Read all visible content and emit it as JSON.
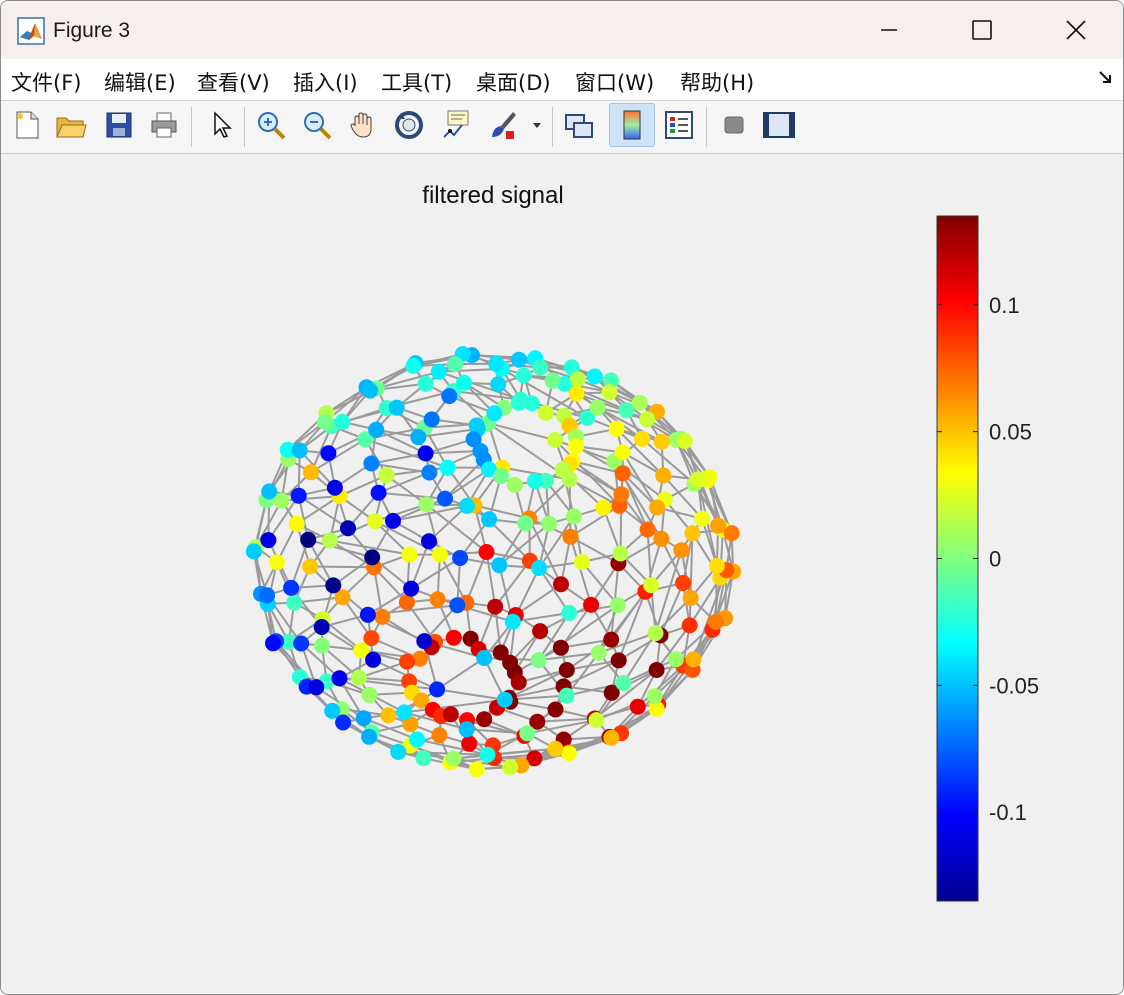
{
  "window": {
    "title": "Figure 3"
  },
  "menu": [
    {
      "label": "文件(F)"
    },
    {
      "label": "编辑(E)"
    },
    {
      "label": "查看(V)"
    },
    {
      "label": "插入(I)"
    },
    {
      "label": "工具(T)"
    },
    {
      "label": "桌面(D)"
    },
    {
      "label": "窗口(W)"
    },
    {
      "label": "帮助(H)"
    }
  ],
  "toolbar": [
    {
      "icon": "new-figure-icon"
    },
    {
      "icon": "open-file-icon"
    },
    {
      "icon": "save-icon"
    },
    {
      "icon": "print-icon"
    },
    {
      "icon": "pointer-icon"
    },
    {
      "icon": "zoom-in-icon"
    },
    {
      "icon": "zoom-out-icon"
    },
    {
      "icon": "pan-hand-icon"
    },
    {
      "icon": "rotate-3d-icon"
    },
    {
      "icon": "data-cursor-icon"
    },
    {
      "icon": "brush-icon"
    },
    {
      "icon": "link-plot-icon"
    },
    {
      "icon": "colorbar-icon",
      "active": true
    },
    {
      "icon": "legend-icon"
    },
    {
      "icon": "hide-plot-tools-icon"
    },
    {
      "icon": "show-plot-tools-icon"
    }
  ],
  "figure": {
    "title": "filtered signal"
  },
  "chart_data": {
    "type": "scatter",
    "title": "filtered signal",
    "colormap": "jet",
    "colorbar": {
      "range": [
        -0.135,
        0.135
      ],
      "ticks": [
        0.1,
        0.05,
        0,
        -0.05,
        -0.1
      ],
      "tick_labels": [
        "0.1",
        "0.05",
        "0",
        "-0.05",
        "-0.1"
      ],
      "placement": "right"
    },
    "grid": false,
    "description_of_marks": "graph signal on a spherical mesh; nodes colored by value, gray edges connecting neighbors"
  }
}
